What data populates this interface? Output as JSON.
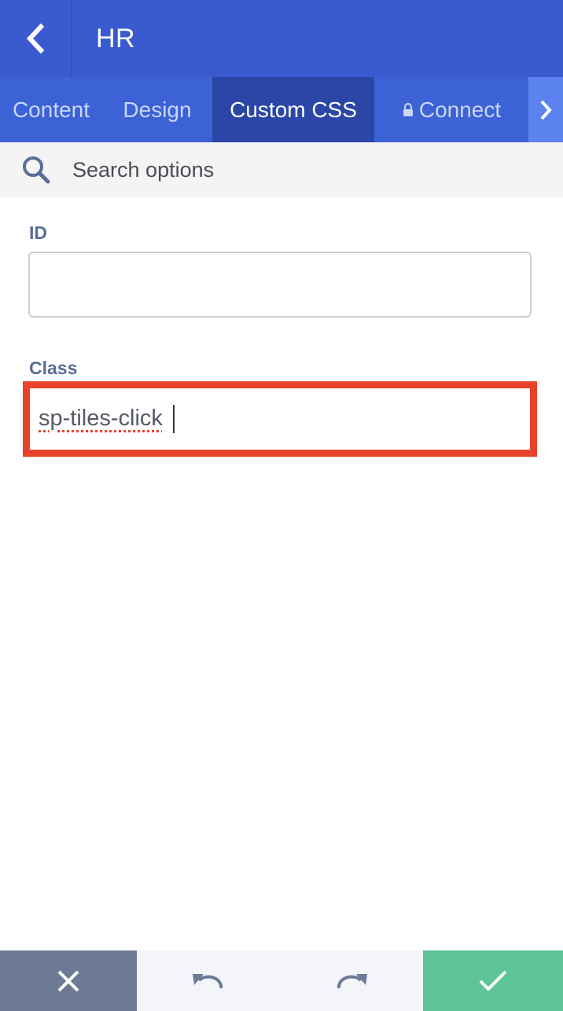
{
  "header": {
    "title": "HR",
    "back_icon": "chevron-left-icon",
    "background_color": "#3a5bd0"
  },
  "tabs": [
    {
      "label": "Content",
      "active": false
    },
    {
      "label": "Design",
      "active": false
    },
    {
      "label": "Custom CSS",
      "active": true
    },
    {
      "label": "Connect",
      "active": false,
      "icon": "lock-icon"
    }
  ],
  "tabs_more_icon": "chevron-right-icon",
  "search": {
    "placeholder": "Search options",
    "icon": "search-icon"
  },
  "fields": {
    "id": {
      "label": "ID",
      "value": ""
    },
    "class": {
      "label": "Class",
      "value": "sp-tiles-click",
      "highlight_color": "#e8422a"
    }
  },
  "footer": {
    "close_icon": "close-icon",
    "undo_icon": "undo-icon",
    "redo_icon": "redo-icon",
    "confirm_icon": "check-icon",
    "close_color": "#6c7a96",
    "confirm_color": "#5cc495"
  }
}
